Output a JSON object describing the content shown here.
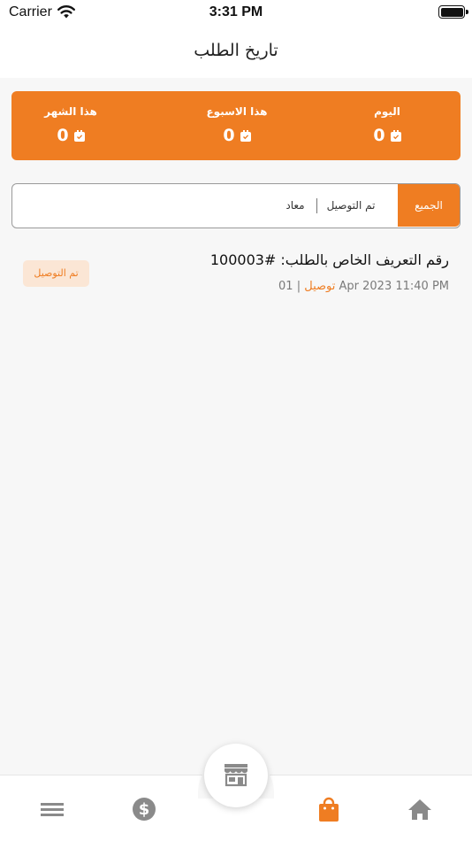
{
  "status_bar": {
    "carrier": "Carrier",
    "time": "3:31 PM"
  },
  "header": {
    "title": "تاريخ الطلب"
  },
  "stats": {
    "today": {
      "label": "اليوم",
      "value": "0"
    },
    "week": {
      "label": "هذا الاسبوع",
      "value": "0"
    },
    "month": {
      "label": "هذا الشهر",
      "value": "0"
    }
  },
  "tabs": {
    "all": "الجميع",
    "delivered": "تم التوصيل",
    "returned": "معاد"
  },
  "orders": [
    {
      "title": "رقم التعريف الخاص بالطلب: #100003",
      "datetime": "01 Apr 2023  11:40 PM",
      "separator": "|",
      "method": "توصيل",
      "status": "تم التوصيل"
    }
  ],
  "colors": {
    "accent": "#ef7d22",
    "badge_bg": "#fbe6d5"
  },
  "icons": {
    "nav": [
      "menu-icon",
      "dollar-icon",
      "store-icon",
      "shopping-bag-icon",
      "home-icon"
    ]
  }
}
